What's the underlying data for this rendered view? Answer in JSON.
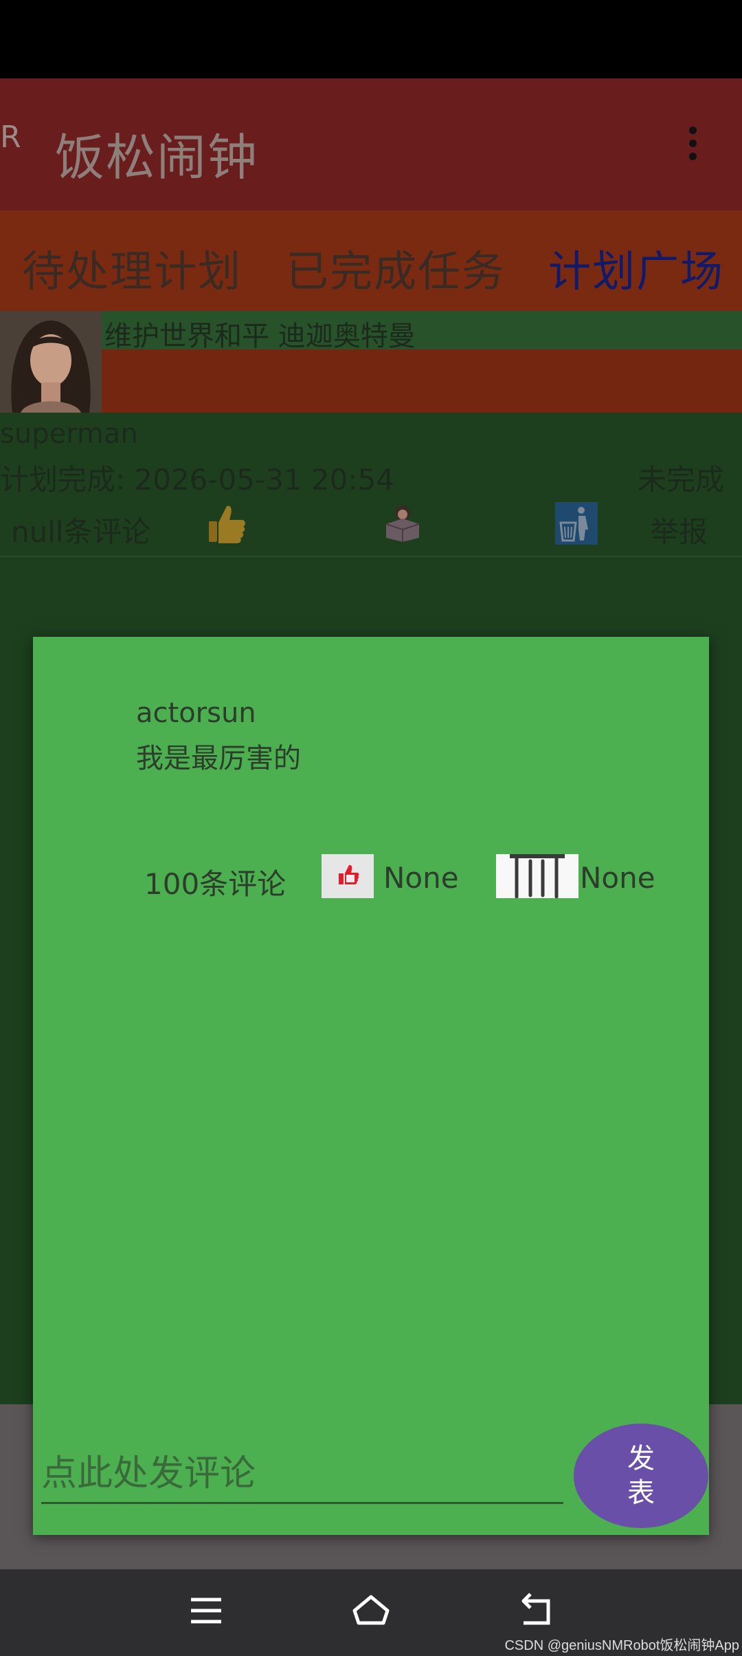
{
  "app_bar": {
    "edge_letter": "R",
    "title": "饭松闹钟"
  },
  "tabs": [
    {
      "label": "待处理计划"
    },
    {
      "label": "已完成任务"
    },
    {
      "label": "计划广场"
    }
  ],
  "post": {
    "title": "维护世界和平 迪迦奥特曼",
    "user": "superman",
    "due_label": "计划完成: 2026-05-31 20:54",
    "status": "未完成",
    "comments": "null条评论",
    "report": "举报"
  },
  "dialog": {
    "comment_user": "actorsun",
    "comment_text": "我是最厉害的",
    "comment_count": "100条评论",
    "like_value": "None",
    "delete_value": "None",
    "input_placeholder": "点此处发评论",
    "send_label_line1": "发",
    "send_label_line2": "表"
  },
  "watermark": "CSDN @geniusNMRobot饭松闹钟App",
  "colors": {
    "app_bar": "#6a1d1d",
    "tab_bar": "#7a2a10",
    "dialog": "#4caf50",
    "send_button": "#6a4fa8",
    "active_tab": "#101a6a"
  }
}
